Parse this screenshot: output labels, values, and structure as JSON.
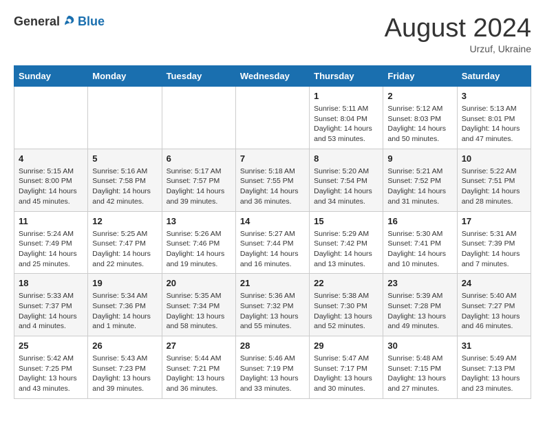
{
  "logo": {
    "general": "General",
    "blue": "Blue"
  },
  "title": "August 2024",
  "subtitle": "Urzuf, Ukraine",
  "days_header": [
    "Sunday",
    "Monday",
    "Tuesday",
    "Wednesday",
    "Thursday",
    "Friday",
    "Saturday"
  ],
  "weeks": [
    [
      {
        "day": "",
        "info": ""
      },
      {
        "day": "",
        "info": ""
      },
      {
        "day": "",
        "info": ""
      },
      {
        "day": "",
        "info": ""
      },
      {
        "day": "1",
        "info": "Sunrise: 5:11 AM\nSunset: 8:04 PM\nDaylight: 14 hours\nand 53 minutes."
      },
      {
        "day": "2",
        "info": "Sunrise: 5:12 AM\nSunset: 8:03 PM\nDaylight: 14 hours\nand 50 minutes."
      },
      {
        "day": "3",
        "info": "Sunrise: 5:13 AM\nSunset: 8:01 PM\nDaylight: 14 hours\nand 47 minutes."
      }
    ],
    [
      {
        "day": "4",
        "info": "Sunrise: 5:15 AM\nSunset: 8:00 PM\nDaylight: 14 hours\nand 45 minutes."
      },
      {
        "day": "5",
        "info": "Sunrise: 5:16 AM\nSunset: 7:58 PM\nDaylight: 14 hours\nand 42 minutes."
      },
      {
        "day": "6",
        "info": "Sunrise: 5:17 AM\nSunset: 7:57 PM\nDaylight: 14 hours\nand 39 minutes."
      },
      {
        "day": "7",
        "info": "Sunrise: 5:18 AM\nSunset: 7:55 PM\nDaylight: 14 hours\nand 36 minutes."
      },
      {
        "day": "8",
        "info": "Sunrise: 5:20 AM\nSunset: 7:54 PM\nDaylight: 14 hours\nand 34 minutes."
      },
      {
        "day": "9",
        "info": "Sunrise: 5:21 AM\nSunset: 7:52 PM\nDaylight: 14 hours\nand 31 minutes."
      },
      {
        "day": "10",
        "info": "Sunrise: 5:22 AM\nSunset: 7:51 PM\nDaylight: 14 hours\nand 28 minutes."
      }
    ],
    [
      {
        "day": "11",
        "info": "Sunrise: 5:24 AM\nSunset: 7:49 PM\nDaylight: 14 hours\nand 25 minutes."
      },
      {
        "day": "12",
        "info": "Sunrise: 5:25 AM\nSunset: 7:47 PM\nDaylight: 14 hours\nand 22 minutes."
      },
      {
        "day": "13",
        "info": "Sunrise: 5:26 AM\nSunset: 7:46 PM\nDaylight: 14 hours\nand 19 minutes."
      },
      {
        "day": "14",
        "info": "Sunrise: 5:27 AM\nSunset: 7:44 PM\nDaylight: 14 hours\nand 16 minutes."
      },
      {
        "day": "15",
        "info": "Sunrise: 5:29 AM\nSunset: 7:42 PM\nDaylight: 14 hours\nand 13 minutes."
      },
      {
        "day": "16",
        "info": "Sunrise: 5:30 AM\nSunset: 7:41 PM\nDaylight: 14 hours\nand 10 minutes."
      },
      {
        "day": "17",
        "info": "Sunrise: 5:31 AM\nSunset: 7:39 PM\nDaylight: 14 hours\nand 7 minutes."
      }
    ],
    [
      {
        "day": "18",
        "info": "Sunrise: 5:33 AM\nSunset: 7:37 PM\nDaylight: 14 hours\nand 4 minutes."
      },
      {
        "day": "19",
        "info": "Sunrise: 5:34 AM\nSunset: 7:36 PM\nDaylight: 14 hours\nand 1 minute."
      },
      {
        "day": "20",
        "info": "Sunrise: 5:35 AM\nSunset: 7:34 PM\nDaylight: 13 hours\nand 58 minutes."
      },
      {
        "day": "21",
        "info": "Sunrise: 5:36 AM\nSunset: 7:32 PM\nDaylight: 13 hours\nand 55 minutes."
      },
      {
        "day": "22",
        "info": "Sunrise: 5:38 AM\nSunset: 7:30 PM\nDaylight: 13 hours\nand 52 minutes."
      },
      {
        "day": "23",
        "info": "Sunrise: 5:39 AM\nSunset: 7:28 PM\nDaylight: 13 hours\nand 49 minutes."
      },
      {
        "day": "24",
        "info": "Sunrise: 5:40 AM\nSunset: 7:27 PM\nDaylight: 13 hours\nand 46 minutes."
      }
    ],
    [
      {
        "day": "25",
        "info": "Sunrise: 5:42 AM\nSunset: 7:25 PM\nDaylight: 13 hours\nand 43 minutes."
      },
      {
        "day": "26",
        "info": "Sunrise: 5:43 AM\nSunset: 7:23 PM\nDaylight: 13 hours\nand 39 minutes."
      },
      {
        "day": "27",
        "info": "Sunrise: 5:44 AM\nSunset: 7:21 PM\nDaylight: 13 hours\nand 36 minutes."
      },
      {
        "day": "28",
        "info": "Sunrise: 5:46 AM\nSunset: 7:19 PM\nDaylight: 13 hours\nand 33 minutes."
      },
      {
        "day": "29",
        "info": "Sunrise: 5:47 AM\nSunset: 7:17 PM\nDaylight: 13 hours\nand 30 minutes."
      },
      {
        "day": "30",
        "info": "Sunrise: 5:48 AM\nSunset: 7:15 PM\nDaylight: 13 hours\nand 27 minutes."
      },
      {
        "day": "31",
        "info": "Sunrise: 5:49 AM\nSunset: 7:13 PM\nDaylight: 13 hours\nand 23 minutes."
      }
    ]
  ]
}
